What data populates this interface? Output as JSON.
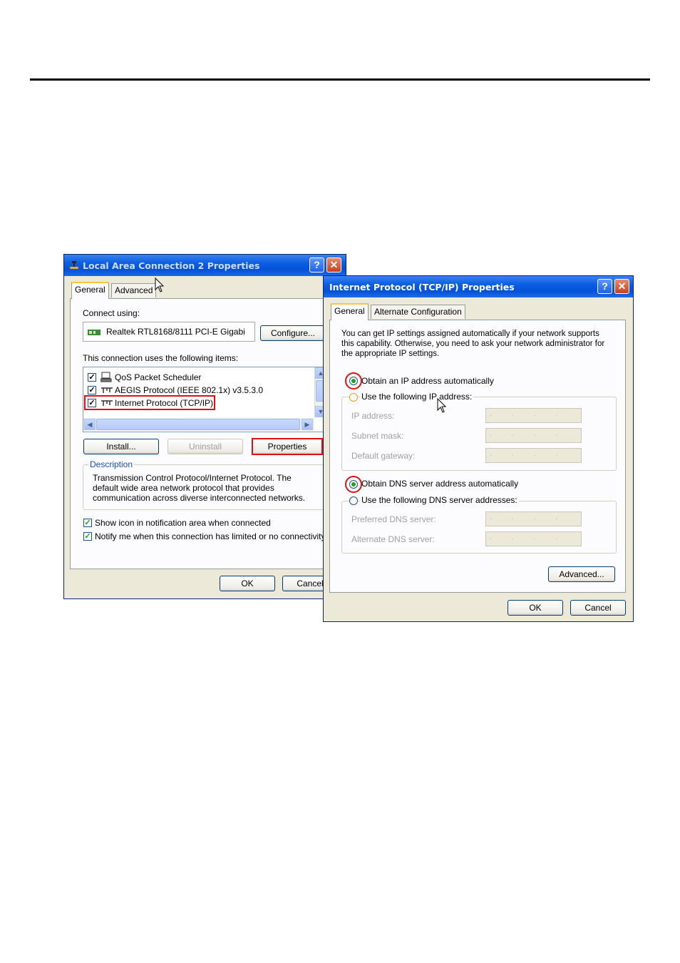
{
  "lan_dialog": {
    "title": "Local Area Connection 2 Properties",
    "tabs": [
      "General",
      "Advanced"
    ],
    "connect_using_label": "Connect using:",
    "adapter_name": "Realtek RTL8168/8111 PCI-E Gigabi",
    "configure_label": "Configure...",
    "items_label": "This connection uses the following items:",
    "items": [
      {
        "label": "QoS Packet Scheduler",
        "checked": true
      },
      {
        "label": "AEGIS Protocol (IEEE 802.1x) v3.5.3.0",
        "checked": true
      },
      {
        "label": "Internet Protocol (TCP/IP)",
        "checked": true
      }
    ],
    "install_label": "Install...",
    "uninstall_label": "Uninstall",
    "properties_label": "Properties",
    "description_legend": "Description",
    "description_text": "Transmission Control Protocol/Internet Protocol. The default wide area network protocol that provides communication across diverse interconnected networks.",
    "show_icon_label": "Show icon in notification area when connected",
    "notify_label": "Notify me when this connection has limited or no connectivity",
    "ok_label": "OK",
    "cancel_label": "Cancel"
  },
  "tcpip_dialog": {
    "title": "Internet Protocol (TCP/IP) Properties",
    "tabs": [
      "General",
      "Alternate Configuration"
    ],
    "intro_text": "You can get IP settings assigned automatically if your network supports this capability. Otherwise, you need to ask your network administrator for the appropriate IP settings.",
    "obtain_ip_label": "Obtain an IP address automatically",
    "use_ip_label": "Use the following IP address:",
    "ip_address_label": "IP address:",
    "subnet_label": "Subnet mask:",
    "gateway_label": "Default gateway:",
    "obtain_dns_label": "Obtain DNS server address automatically",
    "use_dns_label": "Use the following DNS server addresses:",
    "preferred_dns_label": "Preferred DNS server:",
    "alternate_dns_label": "Alternate DNS server:",
    "advanced_label": "Advanced...",
    "ok_label": "OK",
    "cancel_label": "Cancel",
    "field_dots": "...."
  },
  "colors": {
    "titlebar_blue": "#0a5ee0",
    "dialog_bg": "#ece9d8",
    "highlight_red": "#e01010",
    "radio_green": "#21a121"
  },
  "icons": [
    "network-connection-icon",
    "help-icon",
    "close-icon",
    "network-adapter-icon",
    "qos-icon",
    "protocol-icon",
    "mouse-cursor-icon"
  ]
}
